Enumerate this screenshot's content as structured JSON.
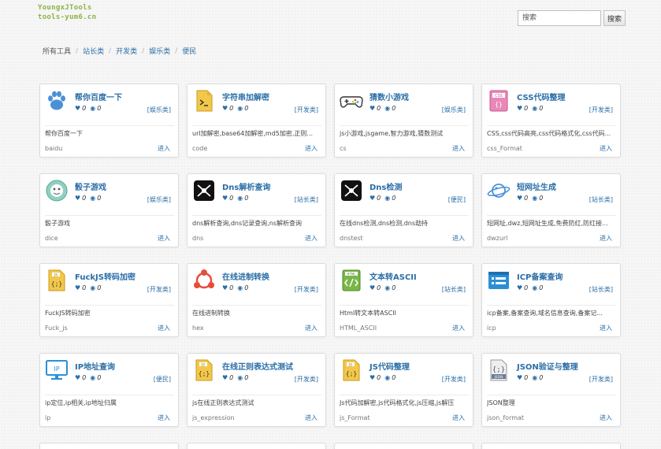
{
  "logo": {
    "line1": "YoungxJTools",
    "line2": "tools-yum6.cn"
  },
  "search": {
    "placeholder": "搜索",
    "button_label": "搜索"
  },
  "breadcrumb": [
    "所有工具",
    "站长类",
    "开发类",
    "娱乐类",
    "便民"
  ],
  "cards": [
    {
      "title": "帮你百度一下",
      "likes": "0",
      "views": "0",
      "category": "[娱乐类]",
      "desc": "帮你百度一下",
      "code": "baidu",
      "enter": "进入",
      "icon": "paw-icon"
    },
    {
      "title": "字符串加解密",
      "likes": "0",
      "views": "0",
      "category": "[开发类]",
      "desc": "url加解密,base64加解密,md5加密,正则...",
      "code": "code",
      "enter": "进入",
      "icon": "terminal-file-icon"
    },
    {
      "title": "猜数小游戏",
      "likes": "0",
      "views": "0",
      "category": "[娱乐类]",
      "desc": "js小游戏,jsgame,智力游戏,猜数测试",
      "code": "cs",
      "enter": "进入",
      "icon": "gamepad-icon"
    },
    {
      "title": "CSS代码整理",
      "likes": "0",
      "views": "0",
      "category": "[开发类]",
      "desc": "CSS,css代码高亮,css代码格式化,css代码...",
      "code": "css_Format",
      "enter": "进入",
      "icon": "css-file-icon"
    },
    {
      "title": "骰子游戏",
      "likes": "0",
      "views": "0",
      "category": "[娱乐类]",
      "desc": "骰子游戏",
      "code": "dice",
      "enter": "进入",
      "icon": "dice-icon"
    },
    {
      "title": "Dns解析查询",
      "likes": "0",
      "views": "0",
      "category": "[站长类]",
      "desc": "dns解析查询,dns记录查询,ns解析查询",
      "code": "dns",
      "enter": "进入",
      "icon": "dns-icon"
    },
    {
      "title": "Dns检测",
      "likes": "0",
      "views": "0",
      "category": "[便民]",
      "desc": "在线dns检测,dns检测,dns劫持",
      "code": "dnstest",
      "enter": "进入",
      "icon": "dns-test-icon"
    },
    {
      "title": "短网址生成",
      "likes": "0",
      "views": "0",
      "category": "[站长类]",
      "desc": "短网址,dwz,短网址生成,免费防红,防红接...",
      "code": "dwzurl",
      "enter": "进入",
      "icon": "planet-icon"
    },
    {
      "title": "FuckJS转码加密",
      "likes": "0",
      "views": "0",
      "category": "[开发类]",
      "desc": "FuckJS转码加密",
      "code": "Fuck_js",
      "enter": "进入",
      "icon": "js-file-icon"
    },
    {
      "title": "在线进制转换",
      "likes": "0",
      "views": "0",
      "category": "[开发类]",
      "desc": "在线进制转换",
      "code": "hex",
      "enter": "进入",
      "icon": "hex-convert-icon"
    },
    {
      "title": "文本转ASCII",
      "likes": "0",
      "views": "0",
      "category": "[站长类]",
      "desc": "Html转文本转ASCII",
      "code": "HTML_ASCII",
      "enter": "进入",
      "icon": "html-file-icon"
    },
    {
      "title": "ICP备案查询",
      "likes": "0",
      "views": "0",
      "category": "[站长类]",
      "desc": "icp备案,备案查询,域名信息查询,备案记...",
      "code": "icp",
      "enter": "进入",
      "icon": "list-window-icon"
    },
    {
      "title": "IP地址查询",
      "likes": "0",
      "views": "0",
      "category": "[便民]",
      "desc": "ip定位,ip相关,ip地址归属",
      "code": "ip",
      "enter": "进入",
      "icon": "ip-monitor-icon"
    },
    {
      "title": "在线正则表达式测试",
      "likes": "0",
      "views": "0",
      "category": "[开发类]",
      "desc": "js在线正则表达式测试",
      "code": "js_expression",
      "enter": "进入",
      "icon": "js-file-icon"
    },
    {
      "title": "JS代码整理",
      "likes": "0",
      "views": "0",
      "category": "[开发类]",
      "desc": "Js代码加解密,js代码格式化,js压缩,js解压",
      "code": "js_Format",
      "enter": "进入",
      "icon": "js-file-icon"
    },
    {
      "title": "JSON验证与整理",
      "likes": "0",
      "views": "0",
      "category": "[开发类]",
      "desc": "JSON整理",
      "code": "json_format",
      "enter": "进入",
      "icon": "json-file-icon"
    }
  ],
  "colors": {
    "link": "#2a6ea7",
    "logo": "#8ab346"
  }
}
